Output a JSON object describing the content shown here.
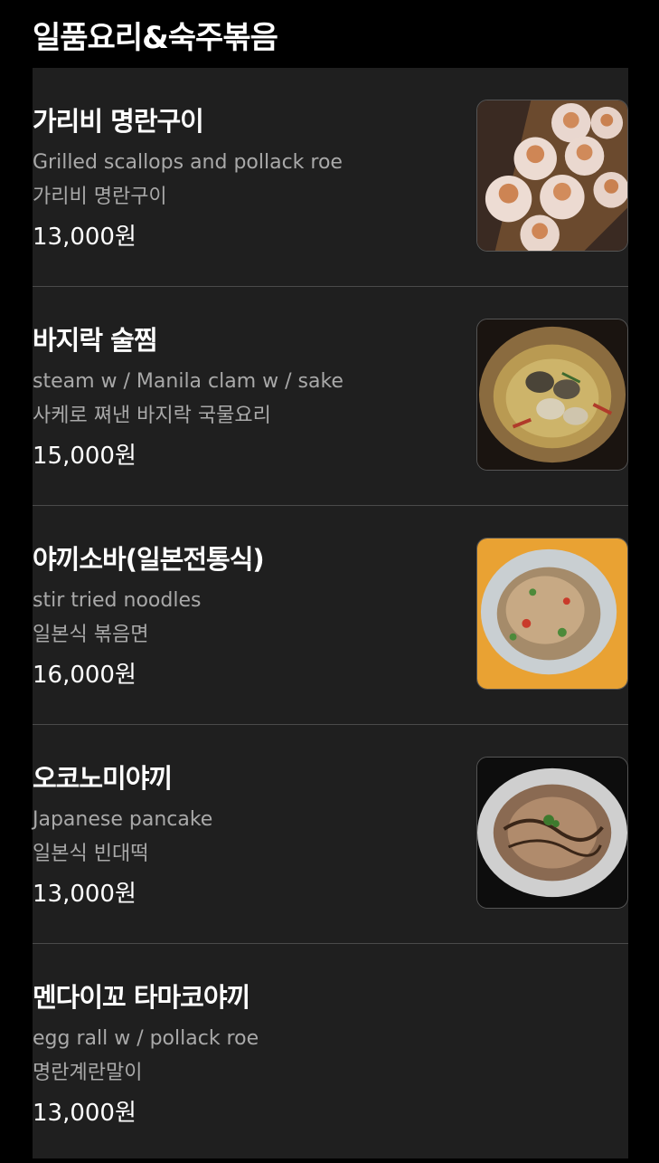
{
  "header": {
    "title": "일품요리&숙주볶음"
  },
  "items": [
    {
      "name": "가리비 명란구이",
      "desc_en": "Grilled scallops and pollack roe",
      "desc_ko": "가리비 명란구이",
      "price": "13,000원",
      "photo_icon": "scallop-dish-photo"
    },
    {
      "name": "바지락 술찜",
      "desc_en": "steam w / Manila clam w / sake",
      "desc_ko": "사케로 쪄낸 바지락 국물요리",
      "price": "15,000원",
      "photo_icon": "clam-dish-photo"
    },
    {
      "name": "야끼소바(일본전통식)",
      "desc_en": "stir tried noodles",
      "desc_ko": "일본식 볶음면",
      "price": "16,000원",
      "photo_icon": "yakisoba-dish-photo"
    },
    {
      "name": "오코노미야끼",
      "desc_en": "Japanese pancake",
      "desc_ko": "일본식 빈대떡",
      "price": "13,000원",
      "photo_icon": "okonomiyaki-dish-photo"
    },
    {
      "name": "멘다이꼬 타마코야끼",
      "desc_en": "egg rall w / pollack roe",
      "desc_ko": "명란계란말이",
      "price": "13,000원"
    }
  ],
  "colors": {
    "background": "#000000",
    "panel": "#1f1f1f",
    "muted_text": "#a9a9a9",
    "divider": "#4a4a4a"
  }
}
